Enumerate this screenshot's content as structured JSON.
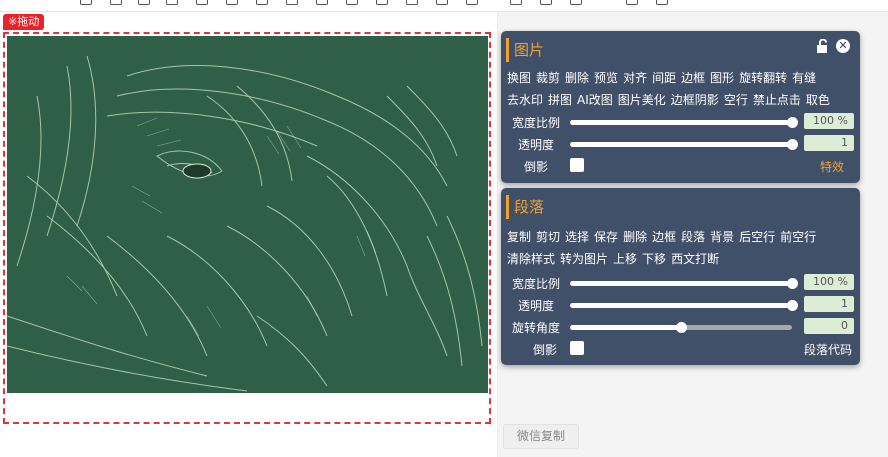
{
  "editor": {
    "drag_tag": "※拖动"
  },
  "image_panel": {
    "title": "图片",
    "actions_row1": [
      "换图",
      "裁剪",
      "删除",
      "预览",
      "对齐",
      "间距",
      "边框",
      "图形",
      "旋转翻转",
      "有缝"
    ],
    "actions_row2": [
      "去水印",
      "拼图",
      "AI改图",
      "图片美化",
      "边框阴影",
      "空行",
      "禁止点击",
      "取色"
    ],
    "sliders": [
      {
        "label": "宽度比例",
        "value": "100 %",
        "level": 1.0
      },
      {
        "label": "透明度",
        "value": "1",
        "level": 1.0
      }
    ],
    "shadow_label": "倒影",
    "effects_link": "特效"
  },
  "paragraph_panel": {
    "title": "段落",
    "actions_row1": [
      "复制",
      "剪切",
      "选择",
      "保存",
      "删除",
      "边框",
      "段落",
      "背景",
      "后空行",
      "前空行"
    ],
    "actions_row2": [
      "清除样式",
      "转为图片",
      "上移",
      "下移",
      "西文打断"
    ],
    "sliders": [
      {
        "label": "宽度比例",
        "value": "100 %",
        "level": 1.0
      },
      {
        "label": "透明度",
        "value": "1",
        "level": 1.0
      },
      {
        "label": "旋转角度",
        "value": "0",
        "level": 0.5
      }
    ],
    "shadow_label": "倒影",
    "code_link": "段落代码"
  },
  "wechat_copy": "微信复制",
  "colors": {
    "panel_bg": "#33435e",
    "accent": "#f3a12c",
    "drag_red": "#e8232a",
    "value_bg": "#dcedd6",
    "chalkboard": "#2f5f46"
  }
}
